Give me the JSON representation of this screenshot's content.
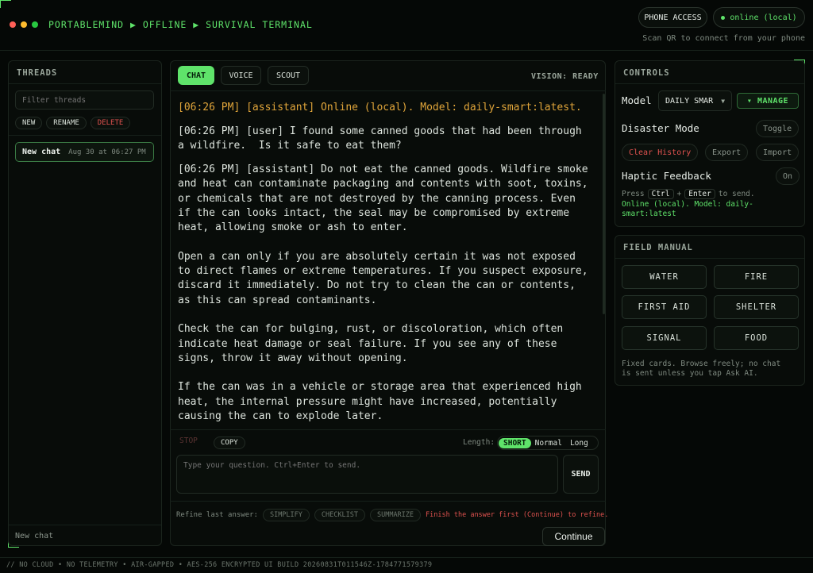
{
  "header": {
    "brand": "PORTABLEMIND ▶ OFFLINE ▶ SURVIVAL TERMINAL",
    "phone_access": "PHONE ACCESS",
    "status": "online (local)",
    "qr_hint": "Scan QR to connect from your phone"
  },
  "threads": {
    "title": "THREADS",
    "filter_placeholder": "Filter threads",
    "new_label": "NEW",
    "rename_label": "RENAME",
    "delete_label": "DELETE",
    "items": [
      {
        "title": "New chat",
        "date": "Aug 30 at 06:27 PM"
      }
    ],
    "footer": "New chat"
  },
  "chat": {
    "tabs": [
      "CHAT",
      "VOICE",
      "SCOUT"
    ],
    "vision_status": "VISION: READY",
    "messages": [
      "[06:26 PM] [assistant] Online (local). Model: daily-smart:latest.",
      "[06:26 PM] [user] I found some canned goods that had been through\na wildfire.  Is it safe to eat them?",
      "[06:26 PM] [assistant] Do not eat the canned goods. Wildfire smoke\nand heat can contaminate packaging and contents with soot, toxins,\nor chemicals that are not destroyed by the canning process. Even\nif the can looks intact, the seal may be compromised by extreme\nheat, allowing smoke or ash to enter.\n\nOpen a can only if you are absolutely certain it was not exposed\nto direct flames or extreme temperatures. If you suspect exposure,\ndiscard it immediately. Do not try to clean the can or contents,\nas this can spread contaminants.\n\nCheck the can for bulging, rust, or discoloration, which often\nindicate heat damage or seal failure. If you see any of these\nsigns, throw it away without opening.\n\nIf the can was in a vehicle or storage area that experienced high\nheat, the internal pressure might have increased, potentially\ncausing the can to explode later."
    ],
    "stop_label": "STOP",
    "copy_label": "COPY",
    "length_label": "Length:",
    "length_options": [
      "SHORT",
      "Normal",
      "Long"
    ],
    "input_placeholder": "Type your question. Ctrl+Enter to send.",
    "send_label": "SEND",
    "refine_label": "Refine last answer:",
    "refine_options": [
      "SIMPLIFY",
      "CHECKLIST",
      "SUMMARIZE"
    ],
    "refine_warning": "Finish the answer first (Continue) to refine.",
    "continue_label": "Continue"
  },
  "controls": {
    "title": "CONTROLS",
    "model_label": "Model",
    "model_value": "DAILY SMAR",
    "manage_label": "▾ MANAGE",
    "disaster_label": "Disaster Mode",
    "toggle_label": "Toggle",
    "clear_history_label": "Clear History",
    "export_label": "Export",
    "import_label": "Import",
    "haptic_label": "Haptic Feedback",
    "haptic_value": "On",
    "press_text": "Press",
    "ctrl_key": "Ctrl",
    "plus": "+",
    "enter_key": "Enter",
    "to_send": "to send.",
    "status_line1": "Online (local). Model: daily-",
    "status_line2": "smart:latest"
  },
  "field_manual": {
    "title": "FIELD MANUAL",
    "cards": [
      "WATER",
      "FIRE",
      "FIRST AID",
      "SHELTER",
      "SIGNAL",
      "FOOD"
    ],
    "note_line1": "Fixed cards. Browse freely; no chat",
    "note_line2": "is sent unless you tap Ask AI."
  },
  "footer": {
    "text": "// NO CLOUD • NO TELEMETRY • AIR-GAPPED • AES-256 ENCRYPTED UI BUILD 20260831T011546Z-1784771579379"
  },
  "colors": {
    "accent": "#5fe36a",
    "assistant_status": "#e0a53a",
    "danger": "#e0524f",
    "background": "#050806"
  }
}
